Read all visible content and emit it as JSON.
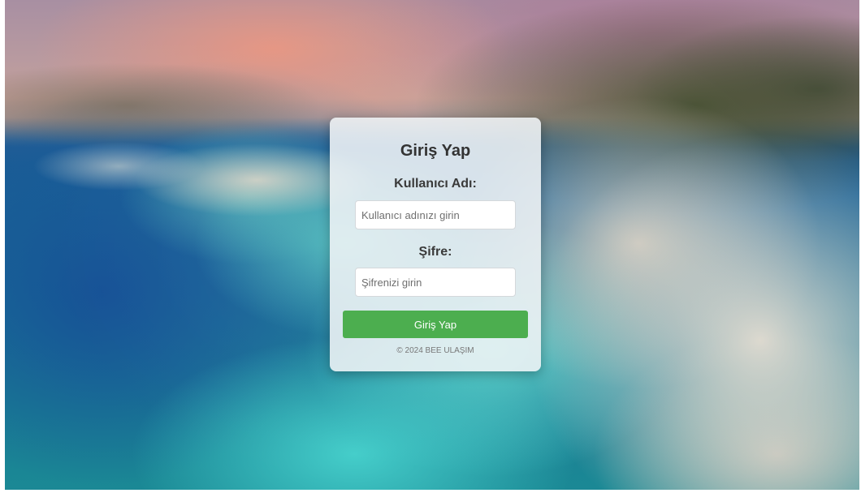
{
  "login": {
    "title": "Giriş Yap",
    "username_label": "Kullanıcı Adı:",
    "username_value": "",
    "username_placeholder": "Kullanıcı adınızı girin",
    "password_label": "Şifre:",
    "password_value": "",
    "password_placeholder": "Şifrenizi girin",
    "submit_label": "Giriş Yap",
    "footer": "© 2024 BEE ULAŞIM"
  },
  "colors": {
    "button": "#4cae4f",
    "card": "#f0f4f6",
    "title_text": "#333333"
  }
}
